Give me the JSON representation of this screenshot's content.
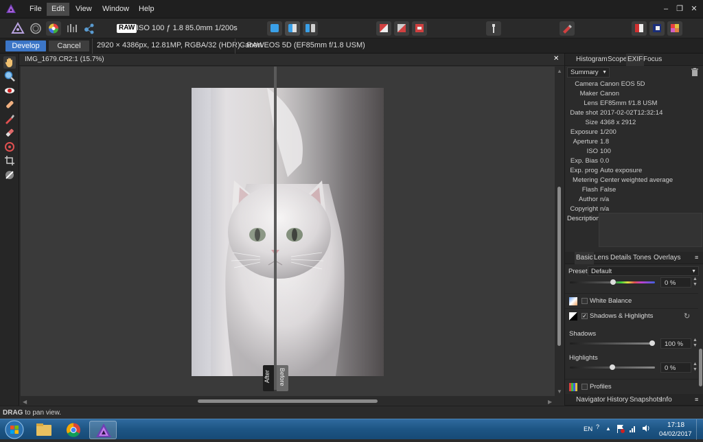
{
  "menu": {
    "items": [
      "File",
      "Edit",
      "View",
      "Window",
      "Help"
    ],
    "active": "Edit"
  },
  "window_controls": {
    "minimize": "–",
    "restore": "❐",
    "close": "✕"
  },
  "toolbar": {
    "raw_badge": "RAW",
    "exposure_info": "ISO 100 ƒ 1.8 85.0mm 1/200s"
  },
  "context": {
    "develop_label": "Develop",
    "cancel_label": "Cancel",
    "image_info": "2920 × 4386px, 12.81MP, RGBA/32 (HDR) - RAW",
    "camera_info": "Canon EOS 5D (EF85mm f/1.8 USM)"
  },
  "document": {
    "tab_title": "IMG_1679.CR2:1 (15.7%)",
    "close_glyph": "✕"
  },
  "split": {
    "after_label": "After",
    "before_label": "Before"
  },
  "exif_panel": {
    "tabs": [
      "Histogram",
      "Scope",
      "EXIF",
      "Focus"
    ],
    "active_tab": "EXIF",
    "mode": "Summary",
    "rows": [
      {
        "key": "Camera",
        "value": "Canon EOS 5D"
      },
      {
        "key": "Maker",
        "value": "Canon"
      },
      {
        "key": "Lens",
        "value": "EF85mm f/1.8 USM"
      },
      {
        "key": "Date shot",
        "value": "2017-02-02T12:32:14"
      },
      {
        "key": "Size",
        "value": "4368 x 2912"
      },
      {
        "key": "Exposure",
        "value": "1/200"
      },
      {
        "key": "Aperture",
        "value": "1.8"
      },
      {
        "key": "ISO",
        "value": "100"
      },
      {
        "key": "Exp. Bias",
        "value": "0.0"
      },
      {
        "key": "Exp. prog",
        "value": "Auto exposure"
      },
      {
        "key": "Metering",
        "value": "Center weighted average"
      },
      {
        "key": "Flash",
        "value": "False"
      },
      {
        "key": "Author",
        "value": "n/a"
      },
      {
        "key": "Copyright",
        "value": "n/a"
      }
    ],
    "description_label": "Description"
  },
  "basic_panel": {
    "tabs": [
      "Basic",
      "Lens",
      "Details",
      "Tones",
      "Overlays"
    ],
    "active_tab": "Basic",
    "preset_label": "Preset:",
    "preset_value": "Default",
    "top_slider_value": "0 %",
    "white_balance_label": "White Balance",
    "white_balance_checked": false,
    "shadows_highlights_label": "Shadows & Highlights",
    "shadows_highlights_checked": true,
    "shadows_label": "Shadows",
    "shadows_value": "100 %",
    "shadows_level": 1.0,
    "highlights_label": "Highlights",
    "highlights_value": "0 %",
    "highlights_level": 0.5,
    "profiles_label": "Profiles",
    "profiles_checked": false
  },
  "bottom_tabs": [
    "Navigator",
    "History",
    "Snapshots",
    "Info"
  ],
  "status": {
    "strong": "DRAG",
    "text": " to pan view."
  },
  "taskbar": {
    "language": "EN",
    "time": "17:18",
    "date": "04/02/2017"
  },
  "colors": {
    "accent": "#3c76c7",
    "panel": "#2b2b2b",
    "canvas": "#3a3a3a"
  }
}
